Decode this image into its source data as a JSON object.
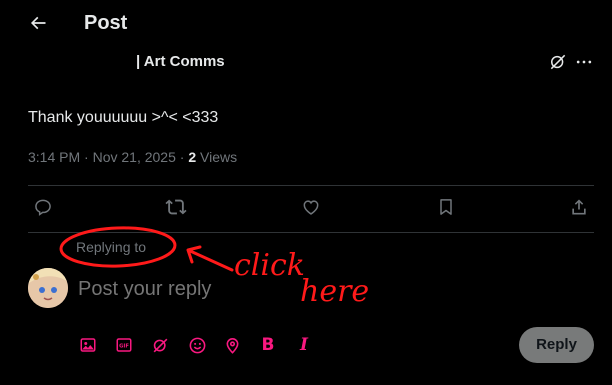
{
  "header": {
    "title": "Post",
    "back_icon": "arrow-left-icon"
  },
  "author": {
    "name": "| Art Comms"
  },
  "post": {
    "text": "Thank youuuuuu >^< <333",
    "time": "3:14 PM",
    "separator": " · ",
    "date": "Nov 21, 2025",
    "views_count": "2",
    "views_label": " Views"
  },
  "actions": [
    "reply-icon",
    "repost-icon",
    "like-icon",
    "bookmark-icon",
    "share-icon"
  ],
  "reply": {
    "replying_to": "Replying to",
    "placeholder": "Post your reply",
    "button_label": "Reply",
    "toolbar": [
      "image-icon",
      "gif-icon",
      "grok-icon",
      "emoji-icon",
      "location-icon",
      "bold-icon",
      "italic-icon"
    ],
    "bold_label": "B",
    "italic_label": "I",
    "gif_label": "GIF"
  },
  "annotation": {
    "line1": "click",
    "line2": "here",
    "color": "#ff1a1a"
  },
  "colors": {
    "background": "#000000",
    "text": "#e7e9ea",
    "muted": "#71767b",
    "accent": "#f91880",
    "divider": "#2f3336"
  }
}
